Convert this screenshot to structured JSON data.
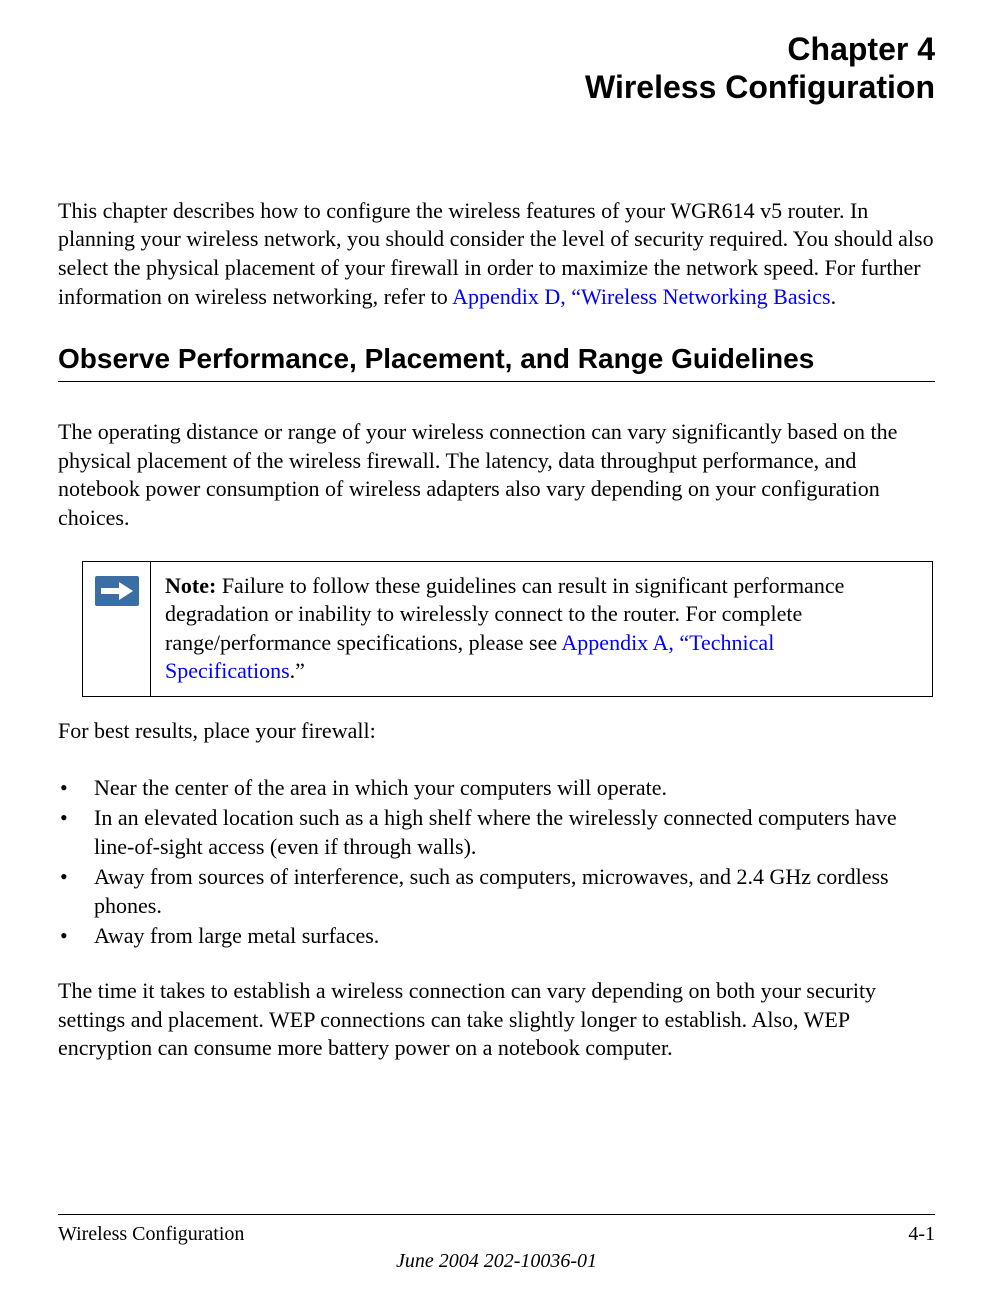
{
  "chapter": {
    "number": "Chapter 4",
    "title": "Wireless Configuration"
  },
  "intro": {
    "text_before_link": "This chapter describes how to configure the wireless features of your WGR614 v5 router. In planning your wireless network, you should consider the level of security required. You should also select the physical placement of your firewall in order to maximize the network speed. For further information on wireless networking, refer to ",
    "link_text": "Appendix D, “Wireless Networking Basics",
    "text_after_link": "."
  },
  "section1": {
    "heading": "Observe Performance, Placement, and Range Guidelines",
    "paragraph1": "The operating distance or range of your wireless connection can vary significantly based on the physical placement of the wireless firewall. The latency, data throughput performance, and notebook power consumption of wireless adapters also vary depending on your configuration choices."
  },
  "note": {
    "label": "Note:",
    "text_before_link": " Failure to follow these guidelines can result in significant performance degradation or inability to wirelessly connect to the router. For complete range/performance specifications, please see ",
    "link_text": "Appendix A, “Technical Specifications",
    "text_after_link": ".”"
  },
  "placement": {
    "intro": "For best results, place your firewall:",
    "bullets": [
      "Near the center of the area in which your computers will operate.",
      "In an elevated location such as a high shelf where the wirelessly connected computers have line-of-sight access (even if through walls).",
      "Away from sources of interference, such as computers, microwaves, and 2.4 GHz cordless phones.",
      "Away from large metal surfaces."
    ]
  },
  "closing_paragraph": "The time it takes to establish a wireless connection can vary depending on both your security settings and placement. WEP connections can take slightly longer to establish. Also, WEP encryption can consume more battery power on a notebook computer.",
  "footer": {
    "left": "Wireless Configuration",
    "right": "4-1",
    "date": "June 2004 202-10036-01"
  }
}
